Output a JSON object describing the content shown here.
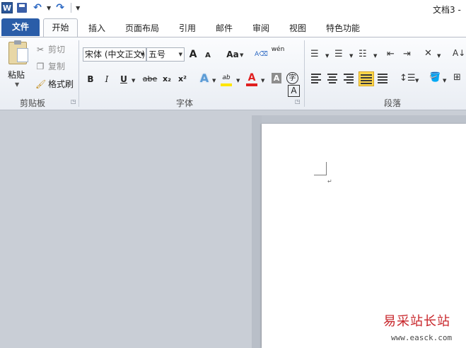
{
  "quick_access": {
    "app_icon": "W",
    "icons": [
      "word-logo-icon",
      "save-icon",
      "undo-icon",
      "redo-icon",
      "customize-icon"
    ]
  },
  "window": {
    "title": "文档3 -"
  },
  "tabs": {
    "file": "文件",
    "home": "开始",
    "insert": "插入",
    "page_layout": "页面布局",
    "references": "引用",
    "mailings": "邮件",
    "review": "审阅",
    "view": "视图",
    "special": "特色功能"
  },
  "clipboard": {
    "paste": "粘贴",
    "cut": "剪切",
    "copy": "复制",
    "format_painter": "格式刷",
    "group_label": "剪贴板"
  },
  "font": {
    "name": "宋体 (中文正文)",
    "size": "五号",
    "grow": "A",
    "shrink": "A",
    "change_case": "Aa",
    "phonetic": "wén",
    "bold": "B",
    "italic": "I",
    "underline": "U",
    "strikethrough": "abe",
    "subscript": "x₂",
    "superscript": "x²",
    "text_effect": "A",
    "highlight": "ab",
    "font_color": "A",
    "char_shading": "A",
    "enclose": "字",
    "border_char": "A",
    "group_label": "字体",
    "highlight_color": "#ffe600",
    "font_color_hex": "#e01f1f"
  },
  "paragraph": {
    "group_label": "段落",
    "sort_symbol": "A↓"
  },
  "watermark": {
    "text": "易采站长站",
    "url": "www.easck.com"
  }
}
